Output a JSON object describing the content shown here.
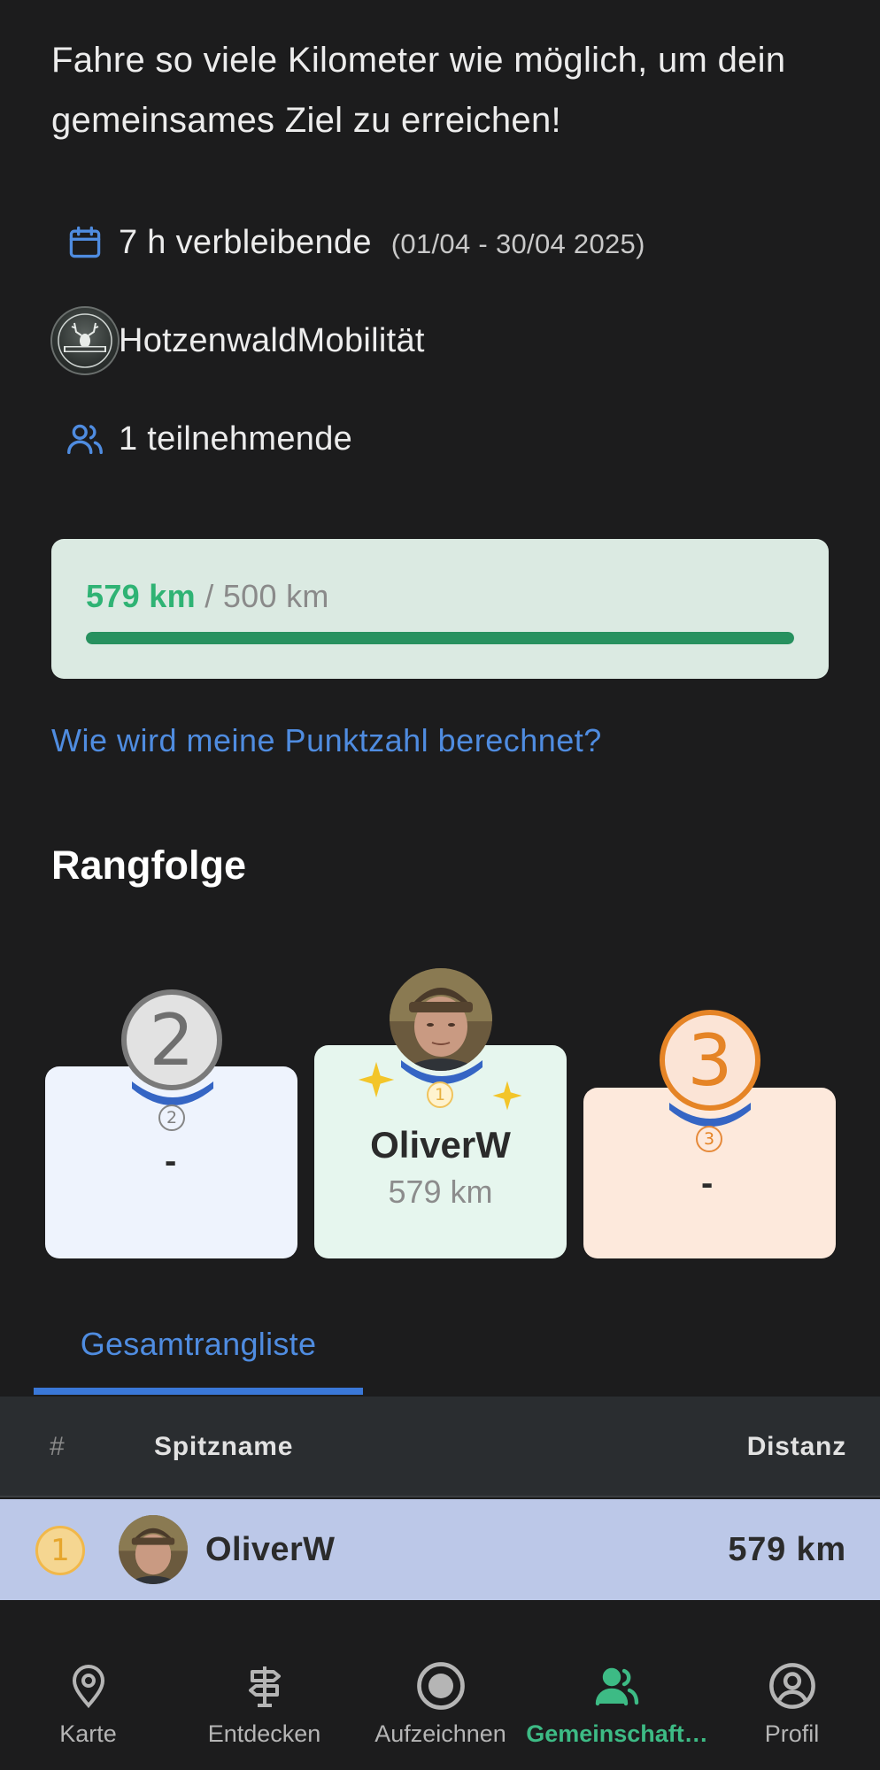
{
  "intro": "Fahre so viele Kilometer wie möglich, um dein gemeinsames Ziel zu erreichen!",
  "info": {
    "remaining": "7 h verbleibende",
    "date_range": "(01/04 - 30/04 2025)",
    "organizer": "HotzenwaldMobilität",
    "participants": "1 teilnehmende",
    "icons": [
      "calendar-icon",
      "organizer-avatar",
      "people-icon"
    ]
  },
  "progress": {
    "current": "579 km",
    "separator": "/",
    "goal": "500 km",
    "fraction": 1.0
  },
  "help_link": "Wie wird meine Punktzahl berechnet?",
  "ranking": {
    "title": "Rangfolge",
    "podium": {
      "first": {
        "rank": "1",
        "name": "OliverW",
        "distance": "579 km"
      },
      "second": {
        "rank": "2",
        "name": "-"
      },
      "third": {
        "rank": "3",
        "name": "-"
      }
    },
    "tab": "Gesamtrangliste",
    "table": {
      "columns": {
        "rank": "#",
        "name": "Spitzname",
        "distance": "Distanz"
      },
      "rows": [
        {
          "rank": "1",
          "name": "OliverW",
          "distance": "579 km"
        }
      ]
    }
  },
  "nav": {
    "items": [
      {
        "label": "Karte",
        "icon": "map-pin-icon"
      },
      {
        "label": "Entdecken",
        "icon": "signpost-icon"
      },
      {
        "label": "Aufzeichnen",
        "icon": "record-icon"
      },
      {
        "label": "Gemeinschaft…",
        "icon": "community-icon",
        "active": true
      },
      {
        "label": "Profil",
        "icon": "profile-icon"
      }
    ]
  },
  "colors": {
    "accent_blue": "#4f8ce0",
    "progress_green": "#27915f",
    "active_nav": "#3dbb85",
    "gold": "#f1b84a",
    "silver": "#7a7a7a",
    "bronze": "#e58426"
  }
}
